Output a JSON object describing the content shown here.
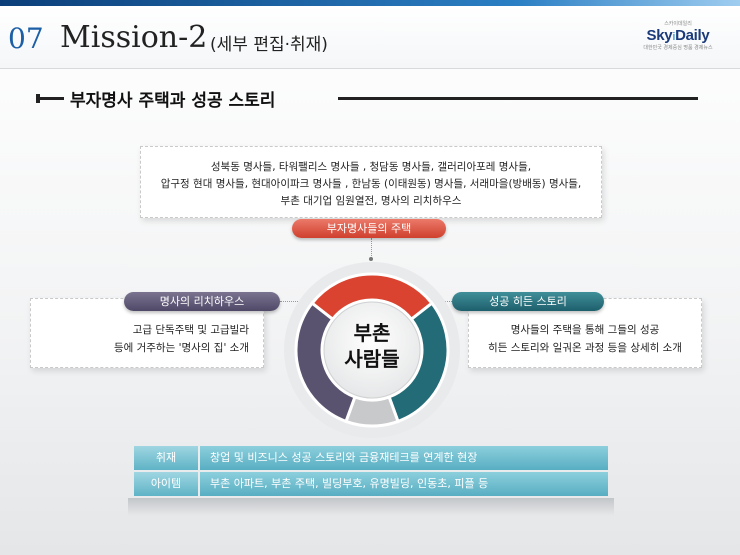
{
  "header": {
    "mission_number": "07",
    "mission_title": "Mission-2",
    "mission_subtitle": "(세부 편집·취재)",
    "logo": {
      "top_text": "스카이데일리",
      "name_main": "Sky",
      "name_i": "i",
      "name_end": "Daily",
      "tagline": "대한민국 경제중심 명품 경제뉴스"
    }
  },
  "section": {
    "title": "부자명사 주택과 성공 스토리"
  },
  "diagram": {
    "center_line1": "부촌",
    "center_line2": "사람들",
    "top": {
      "label": "부자명사들의 주택",
      "lines": [
        "성북동 명사들, 타워팰리스 명사들 , 청담동 명사들, 갤러리아포레 명사들,",
        "압구정 현대 명사들, 현대아이파크 명사들 , 한남동 (이태원동) 명사들, 서래마을(방배동) 명사들,",
        "부촌 대기업 임원열전, 명사의 리치하우스"
      ]
    },
    "left": {
      "label": "명사의 리치하우스",
      "lines": [
        "고급 단독주택 및 고급빌라",
        "등에 거주하는 '명사의 집' 소개"
      ]
    },
    "right": {
      "label": "성공 히든 스토리",
      "lines": [
        "명사들의 주택을 통해 그들의 성공",
        "히든 스토리와 일궈온 과정 등을 상세히 소개"
      ]
    },
    "colors": {
      "red": "#d9432f",
      "teal": "#236b77",
      "purple": "#5a5370",
      "grey": "#c8c9cb"
    }
  },
  "table": {
    "rows": [
      {
        "label": "취재",
        "value": "창업 및 비즈니스 성공 스토리와 금융재테크를 연계한 현장"
      },
      {
        "label": "아이템",
        "value": "부촌 아파트, 부촌 주택, 빌딩부호, 유명빌딩, 인동초, 피플 등"
      }
    ]
  }
}
